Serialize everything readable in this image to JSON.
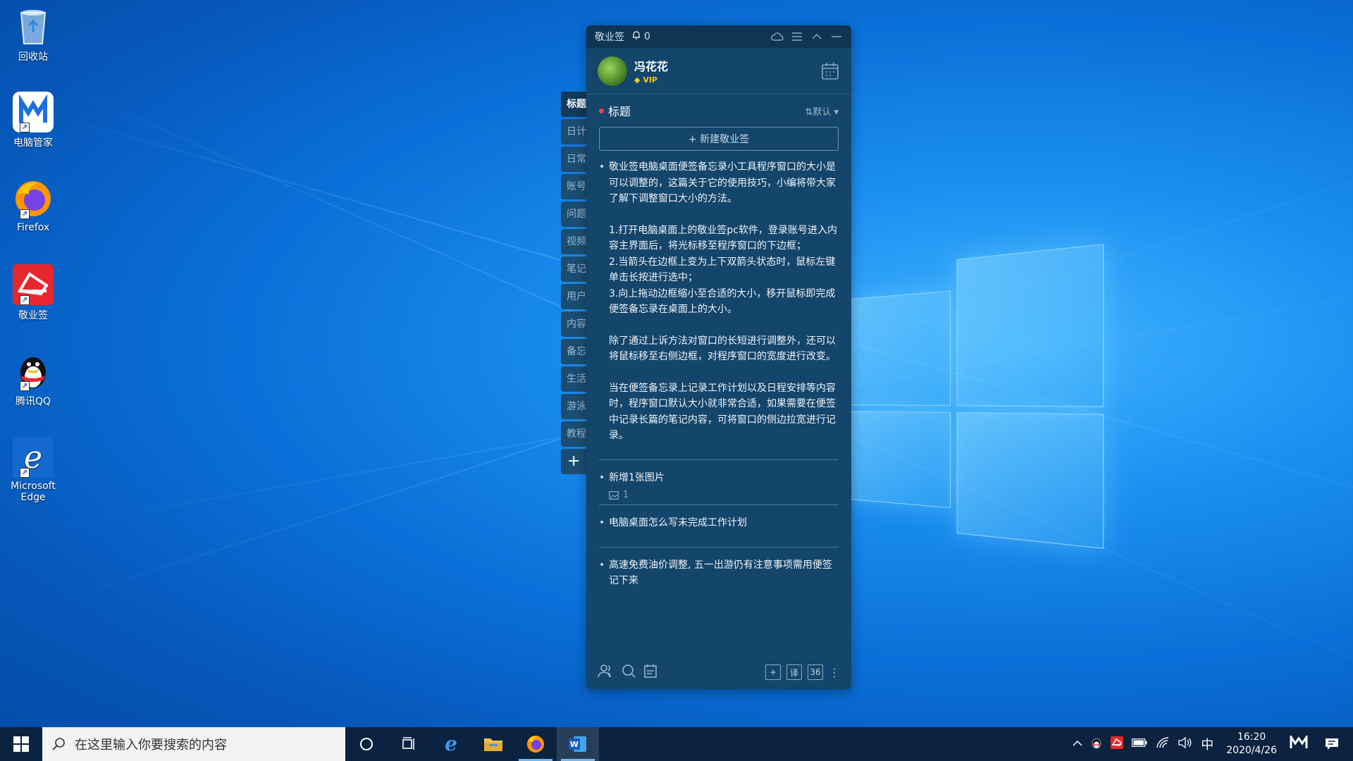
{
  "desktop": {
    "icons": [
      {
        "label": "回收站",
        "icon": "recycle-bin-icon"
      },
      {
        "label": "电脑管家",
        "icon": "pc-manager-icon"
      },
      {
        "label": "Firefox",
        "icon": "firefox-icon"
      },
      {
        "label": "敬业签",
        "icon": "jingyeqian-icon"
      },
      {
        "label": "腾讯QQ",
        "icon": "qq-icon"
      },
      {
        "label": "Microsoft Edge",
        "icon": "edge-icon"
      }
    ]
  },
  "side_tabs": [
    "标题",
    "日计",
    "日常",
    "账号",
    "问题",
    "视频",
    "笔记",
    "用户",
    "内容",
    "备忘",
    "生活",
    "游泳",
    "教程"
  ],
  "app": {
    "title": "敬业签",
    "bell_count": "0",
    "user": {
      "name": "冯花花",
      "badge": "VIP"
    },
    "section": {
      "title": "标题",
      "sort_label": "默认"
    },
    "new_button": "+ 新建敬业签",
    "notes": [
      {
        "paragraphs": [
          "敬业签电脑桌面便签备忘录小工具程序窗口的大小是可以调整的，这篇关于它的使用技巧，小编将带大家了解下调整窗口大小的方法。",
          "1.打开电脑桌面上的敬业签pc软件，登录账号进入内容主界面后，将光标移至程序窗口的下边框；\n2.当箭头在边框上变为上下双箭头状态时，鼠标左键单击长按进行选中；\n3.向上拖动边框缩小至合适的大小，移开鼠标即完成便签备忘录在桌面上的大小。",
          "除了通过上诉方法对窗口的长短进行调整外，还可以将鼠标移至右侧边框，对程序窗口的宽度进行改变。",
          "当在便签备忘录上记录工作计划以及日程安排等内容时，程序窗口默认大小就非常合适，如果需要在便签中记录长篇的笔记内容，可将窗口的侧边拉宽进行记录。"
        ]
      },
      {
        "paragraphs": [
          "新增1张图片"
        ],
        "image_count": "1"
      },
      {
        "paragraphs": [
          "电脑桌面怎么写未完成工作计划"
        ]
      },
      {
        "paragraphs": [
          "高速免费油价调整, 五一出游仍有注意事项需用便签记下来"
        ]
      }
    ],
    "footer": {
      "translate_label": "译",
      "count_label": "36"
    }
  },
  "taskbar": {
    "search_placeholder": "在这里输入你要搜索的内容",
    "ime": "中",
    "time": "16:20",
    "date": "2020/4/26"
  }
}
